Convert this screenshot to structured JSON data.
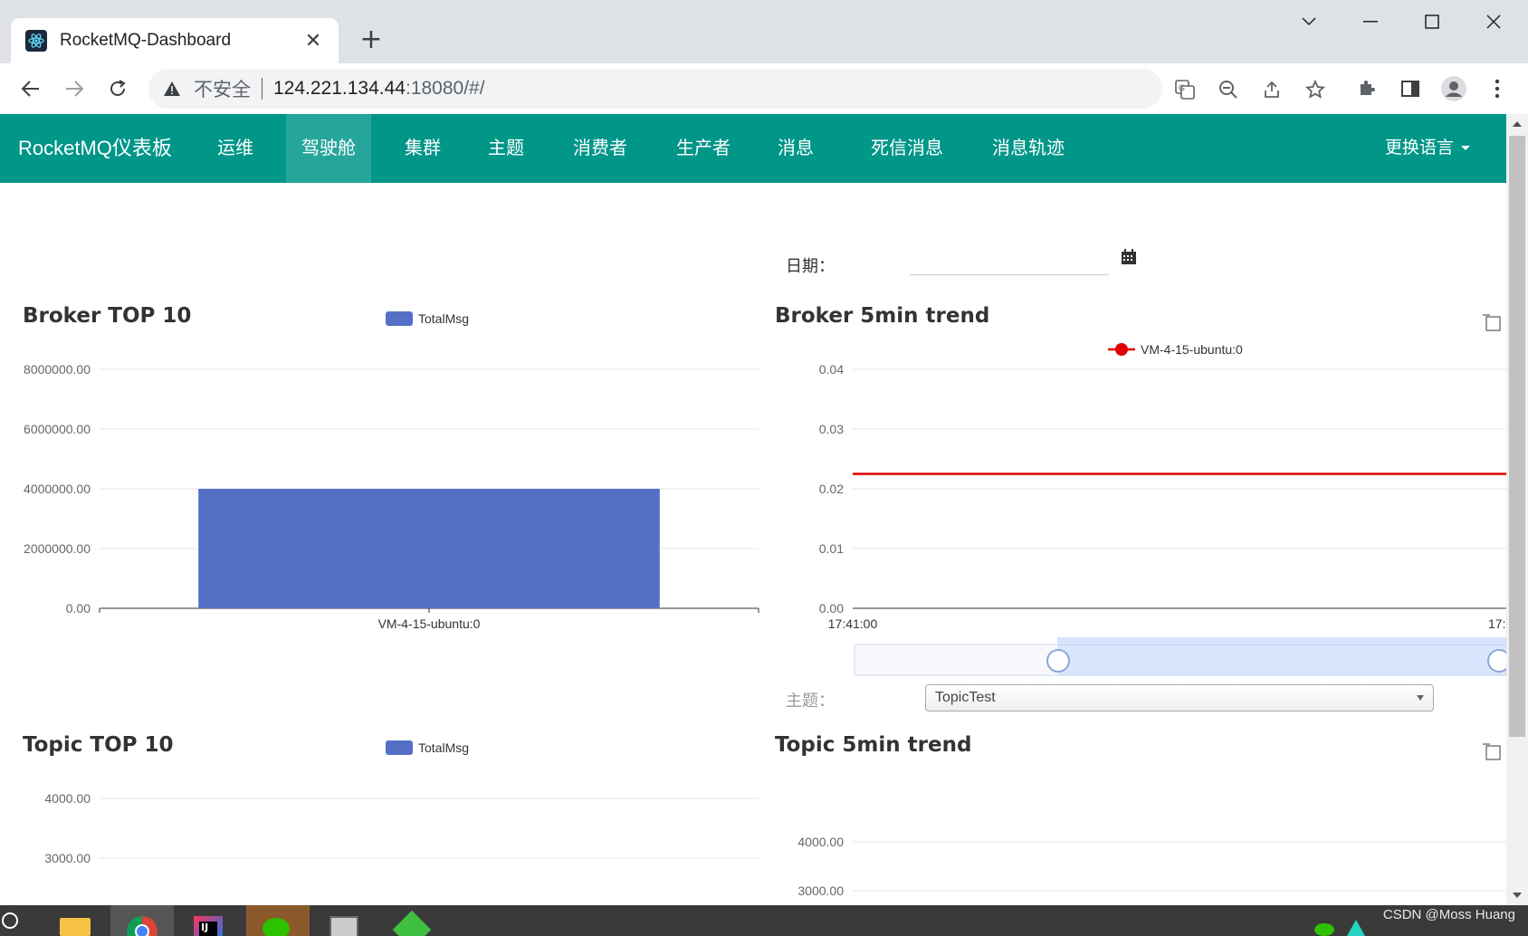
{
  "browser": {
    "tab_title": "RocketMQ-Dashboard",
    "address": {
      "insecure_label": "不安全",
      "host": "124.221.134.44",
      "path": ":18080/#/"
    }
  },
  "nav": {
    "brand": "RocketMQ仪表板",
    "items": [
      "运维",
      "驾驶舱",
      "集群",
      "主题",
      "消费者",
      "生产者",
      "消息",
      "死信消息",
      "消息轨迹"
    ],
    "active_item": "驾驶舱",
    "language": "更换语言"
  },
  "filters": {
    "date_label": "日期：",
    "topic_label": "主题：",
    "topic_selected": "TopicTest"
  },
  "colors": {
    "nav": "#009688",
    "bar": "#5470c6",
    "line": "#e00000"
  },
  "chart_data": [
    {
      "type": "bar",
      "title": "Broker TOP 10",
      "series": [
        {
          "name": "TotalMsg",
          "values": [
            4000000
          ]
        }
      ],
      "categories": [
        "VM-4-15-ubuntu:0"
      ],
      "yticks": [
        "0.00",
        "2000000.00",
        "4000000.00",
        "6000000.00",
        "8000000.00"
      ],
      "ylim": [
        0,
        8000000
      ],
      "legend": "top"
    },
    {
      "type": "line",
      "title": "Broker 5min trend",
      "series": [
        {
          "name": "VM-4-15-ubuntu:0",
          "values": [
            0.0225,
            0.0225
          ]
        }
      ],
      "xticks": [
        "17:41:00",
        "17:"
      ],
      "yticks": [
        "0.00",
        "0.01",
        "0.02",
        "0.03",
        "0.04"
      ],
      "ylim": [
        0,
        0.04
      ],
      "legend": "top-right"
    },
    {
      "type": "bar",
      "title": "Topic TOP 10",
      "series": [
        {
          "name": "TotalMsg",
          "values": []
        }
      ],
      "yticks": [
        "3000.00",
        "4000.00"
      ],
      "legend": "top"
    },
    {
      "type": "line",
      "title": "Topic 5min trend",
      "yticks": [
        "3000.00",
        "4000.00"
      ]
    }
  ],
  "watermark": "CSDN @Moss Huang"
}
